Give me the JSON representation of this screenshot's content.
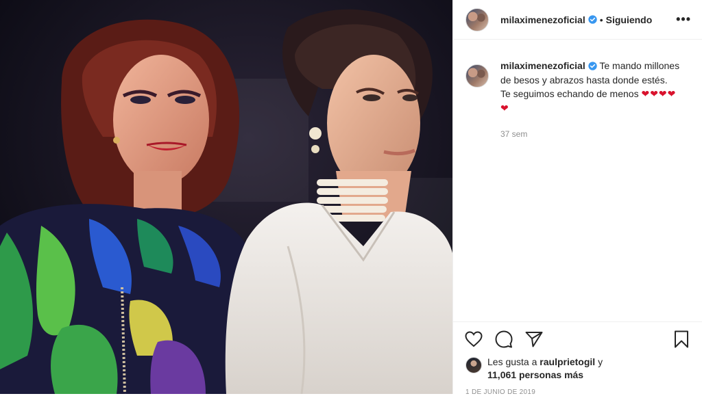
{
  "post": {
    "image_alt": "",
    "author": {
      "username": "milaximenezoficial",
      "verified": true,
      "follow_status": "Siguiendo",
      "separator": "•"
    },
    "caption": {
      "username": "milaximenezoficial",
      "text": "Te mando millones de besos y abrazos hasta donde estés. Te seguimos echando de menos",
      "hearts": "❤❤❤❤❤",
      "time_ago": "37 sem"
    },
    "actions": {
      "like_icon": "heart-outline-icon",
      "comment_icon": "comment-icon",
      "share_icon": "paper-plane-icon",
      "save_icon": "bookmark-icon"
    },
    "likes": {
      "prefix": "Les gusta a",
      "first_user": "raulprietogil",
      "conjunction": "y",
      "others": "11,061 personas más"
    },
    "date": "1 DE JUNIO DE 2019",
    "more_label": "•••"
  },
  "colors": {
    "verified_blue": "#3897f0",
    "heart_red": "#d9122d",
    "text_primary": "#262626",
    "text_secondary": "#8e8e8e",
    "divider": "#efefef"
  }
}
